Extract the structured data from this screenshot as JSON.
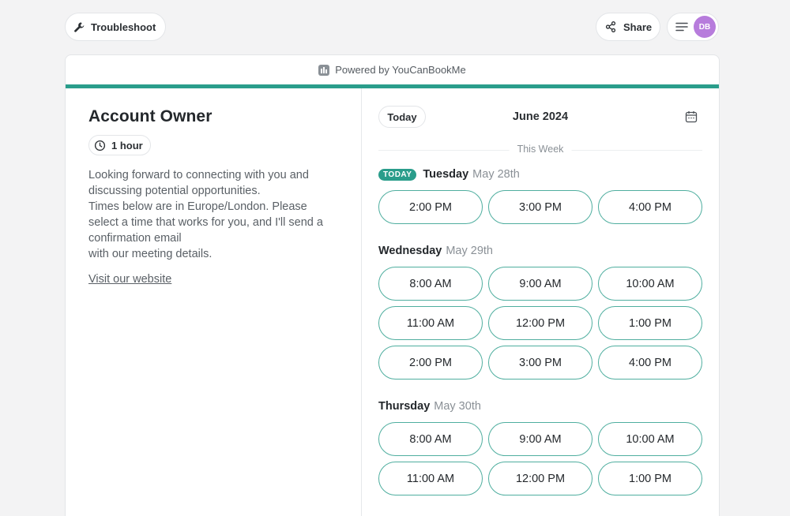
{
  "header": {
    "troubleshoot_label": "Troubleshoot",
    "share_label": "Share",
    "avatar_initials": "DB",
    "avatar_color": "#b77cdc"
  },
  "card": {
    "powered_by": "Powered by YouCanBookMe",
    "accent_color": "#2a9d8b"
  },
  "event": {
    "title": "Account Owner",
    "duration": "1 hour",
    "description_lines": [
      "Looking forward to connecting with you and",
      "discussing potential opportunities.",
      "Times below are in Europe/London. Please",
      "select a time that works for you, and I'll send a",
      "confirmation email",
      "with our meeting details."
    ],
    "website_link": "Visit our website"
  },
  "calendar": {
    "today_button": "Today",
    "month": "June 2024",
    "week_label": "This Week",
    "days": [
      {
        "badge": "TODAY",
        "weekday": "Tuesday",
        "date": "May 28th",
        "slots": [
          "2:00 PM",
          "3:00 PM",
          "4:00 PM"
        ]
      },
      {
        "weekday": "Wednesday",
        "date": "May 29th",
        "slots": [
          "8:00 AM",
          "9:00 AM",
          "10:00 AM",
          "11:00 AM",
          "12:00 PM",
          "1:00 PM",
          "2:00 PM",
          "3:00 PM",
          "4:00 PM"
        ]
      },
      {
        "weekday": "Thursday",
        "date": "May 30th",
        "slots": [
          "8:00 AM",
          "9:00 AM",
          "10:00 AM",
          "11:00 AM",
          "12:00 PM",
          "1:00 PM"
        ]
      }
    ]
  }
}
